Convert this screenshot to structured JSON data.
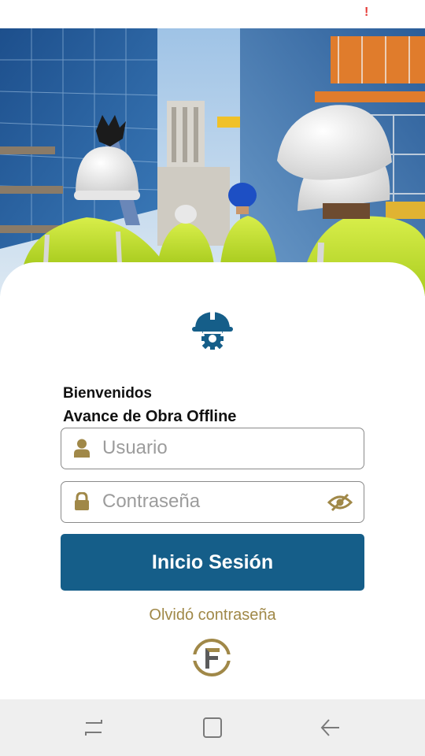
{
  "status_bar": {
    "alert": "!"
  },
  "hero": {
    "icon": "construction-workers-photo"
  },
  "login": {
    "logo_icon": "helmet-gear-icon",
    "welcome": "Bienvenidos",
    "subtitle": "Avance de Obra Offline",
    "username": {
      "placeholder": "Usuario",
      "value": "",
      "icon": "user-icon"
    },
    "password": {
      "placeholder": "Contraseña",
      "value": "",
      "icon": "lock-icon",
      "toggle_icon": "eye-slash-icon"
    },
    "submit_label": "Inicio Sesión",
    "forgot_label": "Olvidó contraseña",
    "brand_icon": "company-logo"
  },
  "nav_bar": {
    "recent_icon": "recent-apps-icon",
    "home_icon": "home-icon",
    "back_icon": "back-icon"
  },
  "colors": {
    "primary": "#155e89",
    "accent": "#a08848",
    "alert": "#e53935",
    "nav_background": "#efefef"
  }
}
